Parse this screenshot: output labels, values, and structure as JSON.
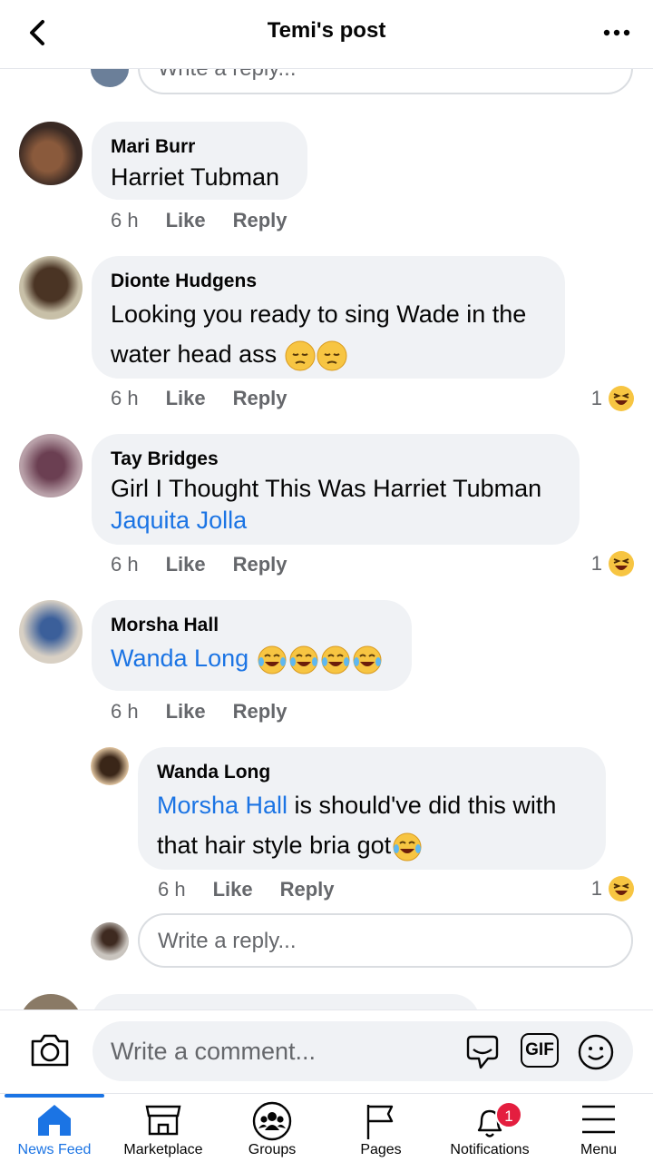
{
  "header": {
    "title": "Temi's post"
  },
  "top_reply_placeholder": "Write a reply...",
  "comments": [
    {
      "name": "Mari Burr",
      "text": "Harriet Tubman",
      "time": "6 h",
      "like": "Like",
      "reply": "Reply"
    },
    {
      "name": "Dionte Hudgens",
      "text_line1": "Looking you ready to sing Wade in the",
      "text_line2": "water head ass",
      "time": "6 h",
      "like": "Like",
      "reply": "Reply",
      "reactions": "1"
    },
    {
      "name": "Tay Bridges",
      "text": "Girl I Thought This Was Harriet Tubman",
      "mention": "Jaquita Jolla",
      "time": "6 h",
      "like": "Like",
      "reply": "Reply",
      "reactions": "1"
    },
    {
      "name": "Morsha Hall",
      "mention": "Wanda Long",
      "time": "6 h",
      "like": "Like",
      "reply": "Reply"
    }
  ],
  "reply": {
    "name": "Wanda Long",
    "mention": "Morsha Hall",
    "text_line1": " is should've did this with",
    "text_line2": "that hair style bria got",
    "time": "6 h",
    "like": "Like",
    "reply": "Reply",
    "reactions": "1"
  },
  "reply_input_placeholder": "Write a reply...",
  "composer": {
    "placeholder": "Write a comment...",
    "gif_label": "GIF"
  },
  "nav": {
    "items": [
      {
        "label": "News Feed",
        "icon": "home-icon"
      },
      {
        "label": "Marketplace",
        "icon": "marketplace-icon"
      },
      {
        "label": "Groups",
        "icon": "groups-icon"
      },
      {
        "label": "Pages",
        "icon": "flag-icon"
      },
      {
        "label": "Notifications",
        "icon": "bell-icon",
        "badge": "1"
      },
      {
        "label": "Menu",
        "icon": "menu-icon"
      }
    ]
  },
  "colors": {
    "accent": "#1b74e4",
    "bubble": "#f0f2f5",
    "badge": "#e41e3f",
    "secondary_text": "#65676b"
  }
}
